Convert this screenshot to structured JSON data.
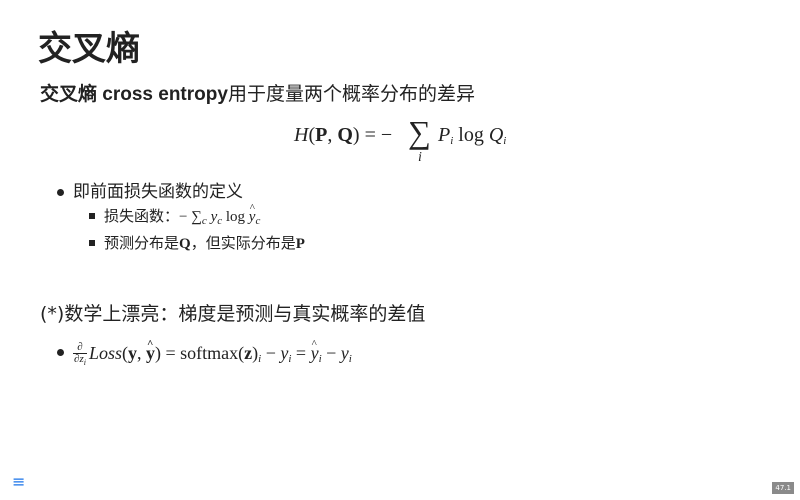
{
  "slide": {
    "title": "交叉熵",
    "subtitle": {
      "prefix_cn": "交叉熵 ",
      "prefix_en": "cross entropy",
      "rest": "用于度量两个概率分布的差异"
    },
    "formula": {
      "lhs": "H(P, Q) = −",
      "sigma": "∑",
      "sum_index": "i",
      "rhs": "P",
      "rhs_sub": "i",
      "log": "log",
      "q": "Q",
      "q_sub": "i"
    },
    "bullets": [
      {
        "text": "即前面损失函数的定义",
        "children": [
          {
            "prefix": "损失函数：",
            "math": "− ∑c yc log ŷc"
          },
          {
            "prefix": "预测分布是",
            "bold1": "Q",
            "mid": "，但实际分布是",
            "bold2": "P"
          }
        ]
      }
    ],
    "section2": {
      "heading": "(*)数学上漂亮：梯度是预测与真实概率的差值",
      "formula": {
        "frac_num": "∂",
        "frac_den": "∂zi",
        "expr": "Loss(y, ŷ) = softmax(z)i − yi = ŷi − yi"
      }
    },
    "menu_icon": "menu-icon",
    "page_number": "47.1"
  }
}
